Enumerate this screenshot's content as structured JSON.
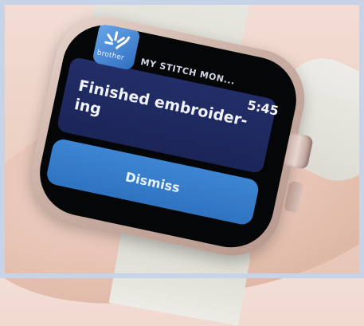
{
  "notification": {
    "app_icon": "brother-logo-icon",
    "brand_text": "brother",
    "app_name": "MY STITCH MON...",
    "time": "5:45",
    "message": "Finished embroider- ing",
    "dismiss_label": "Dismiss"
  },
  "colors": {
    "card": "#1f2a63",
    "button": "#3479c8",
    "icon": "#3f87d6",
    "case": "#c9aea3",
    "band": "#e2e2dc"
  }
}
